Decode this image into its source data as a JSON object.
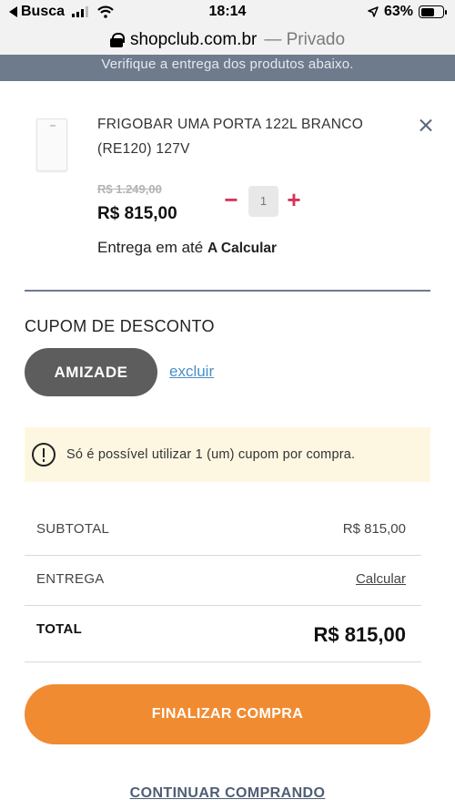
{
  "status_bar": {
    "back_label": "Busca",
    "time": "18:14",
    "battery": "63%",
    "battery_level": 0.63
  },
  "url_bar": {
    "domain": "shopclub.com.br",
    "mode": "— Privado"
  },
  "notice": "Verifique a entrega dos produtos abaixo.",
  "product": {
    "title": "FRIGOBAR UMA PORTA 122L BRANCO (RE120) 127V",
    "old_price": "R$ 1.249,00",
    "price": "R$ 815,00",
    "quantity": "1",
    "minus_symbol": "−",
    "plus_symbol": "+",
    "delivery_prefix": "Entrega em até",
    "delivery_value": "A Calcular"
  },
  "coupon": {
    "heading": "CUPOM DE DESCONTO",
    "code": "AMIZADE",
    "remove_label": "excluir"
  },
  "alert": {
    "icon": "alert-circle-icon",
    "text": "Só é possível utilizar 1 (um) cupom por compra."
  },
  "summary": {
    "subtotal_label": "SUBTOTAL",
    "subtotal_value": "R$ 815,00",
    "shipping_label": "ENTREGA",
    "shipping_value": "Calcular",
    "total_label": "TOTAL",
    "total_value": "R$ 815,00"
  },
  "actions": {
    "finish_label": "FINALIZAR COMPRA",
    "continue_label": "CONTINUAR COMPRANDO"
  },
  "colors": {
    "accent_orange": "#f08b32",
    "qty_controls": "#d7335a",
    "notice_band": "#6e7b8c",
    "alert_bg": "#fdf7e2",
    "link_blue": "#4a8fc7"
  }
}
